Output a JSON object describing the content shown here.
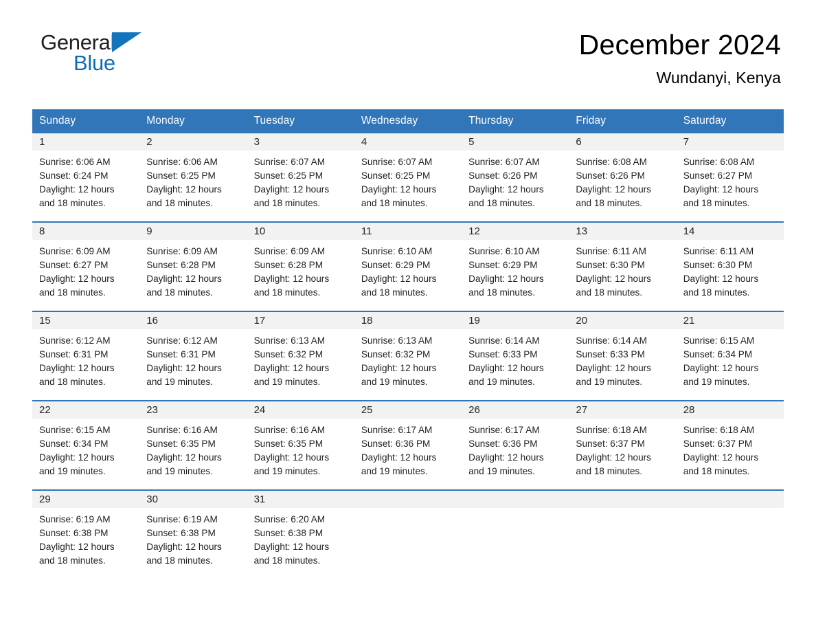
{
  "brand": {
    "name_part1": "General",
    "name_part2": "Blue",
    "accent_color": "#1274bc"
  },
  "header": {
    "month_title": "December 2024",
    "location": "Wundanyi, Kenya"
  },
  "calendar": {
    "header_bg": "#3176b9",
    "daynum_bg": "#f2f2f2",
    "weekday_headers": [
      "Sunday",
      "Monday",
      "Tuesday",
      "Wednesday",
      "Thursday",
      "Friday",
      "Saturday"
    ],
    "weeks": [
      [
        {
          "day": "1",
          "sunrise": "Sunrise: 6:06 AM",
          "sunset": "Sunset: 6:24 PM",
          "daylight_line1": "Daylight: 12 hours",
          "daylight_line2": "and 18 minutes."
        },
        {
          "day": "2",
          "sunrise": "Sunrise: 6:06 AM",
          "sunset": "Sunset: 6:25 PM",
          "daylight_line1": "Daylight: 12 hours",
          "daylight_line2": "and 18 minutes."
        },
        {
          "day": "3",
          "sunrise": "Sunrise: 6:07 AM",
          "sunset": "Sunset: 6:25 PM",
          "daylight_line1": "Daylight: 12 hours",
          "daylight_line2": "and 18 minutes."
        },
        {
          "day": "4",
          "sunrise": "Sunrise: 6:07 AM",
          "sunset": "Sunset: 6:25 PM",
          "daylight_line1": "Daylight: 12 hours",
          "daylight_line2": "and 18 minutes."
        },
        {
          "day": "5",
          "sunrise": "Sunrise: 6:07 AM",
          "sunset": "Sunset: 6:26 PM",
          "daylight_line1": "Daylight: 12 hours",
          "daylight_line2": "and 18 minutes."
        },
        {
          "day": "6",
          "sunrise": "Sunrise: 6:08 AM",
          "sunset": "Sunset: 6:26 PM",
          "daylight_line1": "Daylight: 12 hours",
          "daylight_line2": "and 18 minutes."
        },
        {
          "day": "7",
          "sunrise": "Sunrise: 6:08 AM",
          "sunset": "Sunset: 6:27 PM",
          "daylight_line1": "Daylight: 12 hours",
          "daylight_line2": "and 18 minutes."
        }
      ],
      [
        {
          "day": "8",
          "sunrise": "Sunrise: 6:09 AM",
          "sunset": "Sunset: 6:27 PM",
          "daylight_line1": "Daylight: 12 hours",
          "daylight_line2": "and 18 minutes."
        },
        {
          "day": "9",
          "sunrise": "Sunrise: 6:09 AM",
          "sunset": "Sunset: 6:28 PM",
          "daylight_line1": "Daylight: 12 hours",
          "daylight_line2": "and 18 minutes."
        },
        {
          "day": "10",
          "sunrise": "Sunrise: 6:09 AM",
          "sunset": "Sunset: 6:28 PM",
          "daylight_line1": "Daylight: 12 hours",
          "daylight_line2": "and 18 minutes."
        },
        {
          "day": "11",
          "sunrise": "Sunrise: 6:10 AM",
          "sunset": "Sunset: 6:29 PM",
          "daylight_line1": "Daylight: 12 hours",
          "daylight_line2": "and 18 minutes."
        },
        {
          "day": "12",
          "sunrise": "Sunrise: 6:10 AM",
          "sunset": "Sunset: 6:29 PM",
          "daylight_line1": "Daylight: 12 hours",
          "daylight_line2": "and 18 minutes."
        },
        {
          "day": "13",
          "sunrise": "Sunrise: 6:11 AM",
          "sunset": "Sunset: 6:30 PM",
          "daylight_line1": "Daylight: 12 hours",
          "daylight_line2": "and 18 minutes."
        },
        {
          "day": "14",
          "sunrise": "Sunrise: 6:11 AM",
          "sunset": "Sunset: 6:30 PM",
          "daylight_line1": "Daylight: 12 hours",
          "daylight_line2": "and 18 minutes."
        }
      ],
      [
        {
          "day": "15",
          "sunrise": "Sunrise: 6:12 AM",
          "sunset": "Sunset: 6:31 PM",
          "daylight_line1": "Daylight: 12 hours",
          "daylight_line2": "and 18 minutes."
        },
        {
          "day": "16",
          "sunrise": "Sunrise: 6:12 AM",
          "sunset": "Sunset: 6:31 PM",
          "daylight_line1": "Daylight: 12 hours",
          "daylight_line2": "and 19 minutes."
        },
        {
          "day": "17",
          "sunrise": "Sunrise: 6:13 AM",
          "sunset": "Sunset: 6:32 PM",
          "daylight_line1": "Daylight: 12 hours",
          "daylight_line2": "and 19 minutes."
        },
        {
          "day": "18",
          "sunrise": "Sunrise: 6:13 AM",
          "sunset": "Sunset: 6:32 PM",
          "daylight_line1": "Daylight: 12 hours",
          "daylight_line2": "and 19 minutes."
        },
        {
          "day": "19",
          "sunrise": "Sunrise: 6:14 AM",
          "sunset": "Sunset: 6:33 PM",
          "daylight_line1": "Daylight: 12 hours",
          "daylight_line2": "and 19 minutes."
        },
        {
          "day": "20",
          "sunrise": "Sunrise: 6:14 AM",
          "sunset": "Sunset: 6:33 PM",
          "daylight_line1": "Daylight: 12 hours",
          "daylight_line2": "and 19 minutes."
        },
        {
          "day": "21",
          "sunrise": "Sunrise: 6:15 AM",
          "sunset": "Sunset: 6:34 PM",
          "daylight_line1": "Daylight: 12 hours",
          "daylight_line2": "and 19 minutes."
        }
      ],
      [
        {
          "day": "22",
          "sunrise": "Sunrise: 6:15 AM",
          "sunset": "Sunset: 6:34 PM",
          "daylight_line1": "Daylight: 12 hours",
          "daylight_line2": "and 19 minutes."
        },
        {
          "day": "23",
          "sunrise": "Sunrise: 6:16 AM",
          "sunset": "Sunset: 6:35 PM",
          "daylight_line1": "Daylight: 12 hours",
          "daylight_line2": "and 19 minutes."
        },
        {
          "day": "24",
          "sunrise": "Sunrise: 6:16 AM",
          "sunset": "Sunset: 6:35 PM",
          "daylight_line1": "Daylight: 12 hours",
          "daylight_line2": "and 19 minutes."
        },
        {
          "day": "25",
          "sunrise": "Sunrise: 6:17 AM",
          "sunset": "Sunset: 6:36 PM",
          "daylight_line1": "Daylight: 12 hours",
          "daylight_line2": "and 19 minutes."
        },
        {
          "day": "26",
          "sunrise": "Sunrise: 6:17 AM",
          "sunset": "Sunset: 6:36 PM",
          "daylight_line1": "Daylight: 12 hours",
          "daylight_line2": "and 19 minutes."
        },
        {
          "day": "27",
          "sunrise": "Sunrise: 6:18 AM",
          "sunset": "Sunset: 6:37 PM",
          "daylight_line1": "Daylight: 12 hours",
          "daylight_line2": "and 18 minutes."
        },
        {
          "day": "28",
          "sunrise": "Sunrise: 6:18 AM",
          "sunset": "Sunset: 6:37 PM",
          "daylight_line1": "Daylight: 12 hours",
          "daylight_line2": "and 18 minutes."
        }
      ],
      [
        {
          "day": "29",
          "sunrise": "Sunrise: 6:19 AM",
          "sunset": "Sunset: 6:38 PM",
          "daylight_line1": "Daylight: 12 hours",
          "daylight_line2": "and 18 minutes."
        },
        {
          "day": "30",
          "sunrise": "Sunrise: 6:19 AM",
          "sunset": "Sunset: 6:38 PM",
          "daylight_line1": "Daylight: 12 hours",
          "daylight_line2": "and 18 minutes."
        },
        {
          "day": "31",
          "sunrise": "Sunrise: 6:20 AM",
          "sunset": "Sunset: 6:38 PM",
          "daylight_line1": "Daylight: 12 hours",
          "daylight_line2": "and 18 minutes."
        },
        {
          "day": "",
          "sunrise": "",
          "sunset": "",
          "daylight_line1": "",
          "daylight_line2": ""
        },
        {
          "day": "",
          "sunrise": "",
          "sunset": "",
          "daylight_line1": "",
          "daylight_line2": ""
        },
        {
          "day": "",
          "sunrise": "",
          "sunset": "",
          "daylight_line1": "",
          "daylight_line2": ""
        },
        {
          "day": "",
          "sunrise": "",
          "sunset": "",
          "daylight_line1": "",
          "daylight_line2": ""
        }
      ]
    ]
  }
}
